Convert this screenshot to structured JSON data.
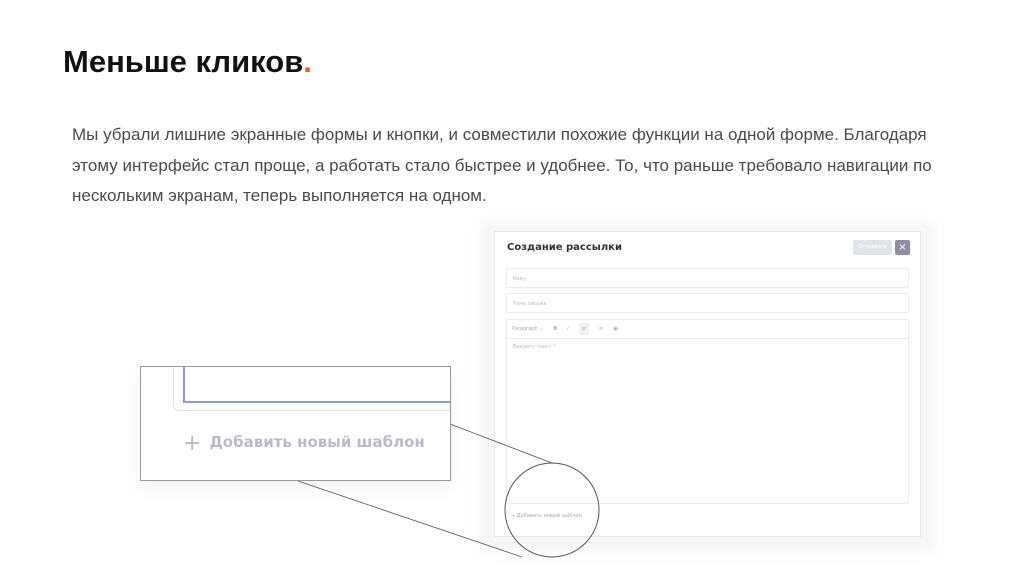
{
  "heading": {
    "text": "Меньше кликов",
    "dot": "."
  },
  "paragraph": "Мы убрали лишние экранные формы и кнопки, и совместили похожие функции на одной форме. Благодаря этому интерфейс стал проще, а работать стало быстрее и удобнее. То, что раньше требовало навигации по нескольким экранам, теперь выполняется на одном.",
  "form": {
    "title": "Создание рассылки",
    "send_label": "Отправить",
    "close_icon": "×",
    "to_placeholder": "Кому",
    "subject_placeholder": "Тема письма",
    "toolbar": {
      "paragraph": "Paragraph ⌄",
      "bold": "B",
      "italic": "I",
      "align_left": "≡",
      "align_center": "≡",
      "image": "▣"
    },
    "body_placeholder": "Введите текст *",
    "add_template": "+ Добавить новый шаблон"
  },
  "zoom": {
    "plus": "+",
    "add_template": "Добавить новый шаблон"
  }
}
